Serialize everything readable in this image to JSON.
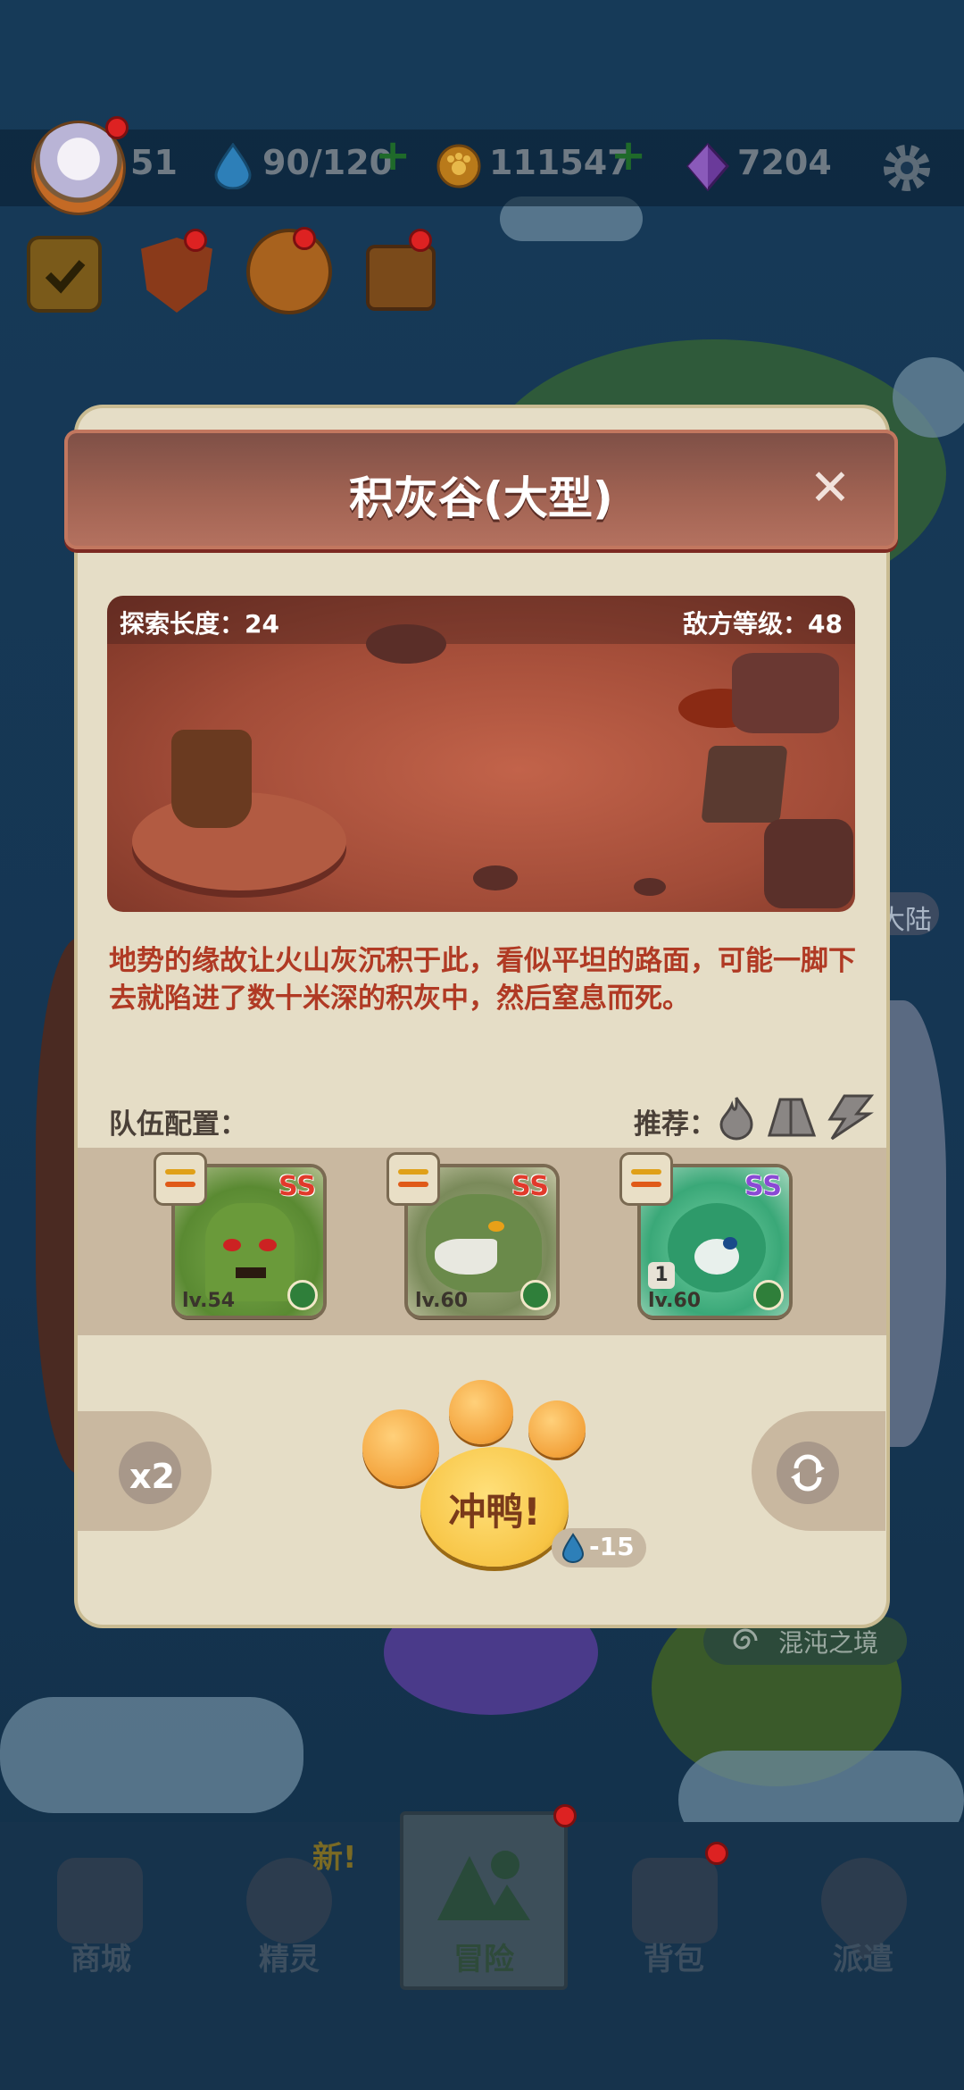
{
  "status_bar": {
    "level": "51",
    "energy": "90/120",
    "coins": "111547",
    "gems": "7204"
  },
  "dialog": {
    "title": "积灰谷(大型)",
    "close_label": "✕",
    "explore_length": "探索长度：24",
    "enemy_level": "敌方等级：48",
    "description": "地势的缘故让火山灰沉积于此，看似平坦的路面，可能一脚下去就陷进了数十米深的积灰中，然后窒息而死。",
    "team_label": "队伍配置：",
    "recommend_label": "推荐：",
    "recommend_icons": [
      "fire-icon",
      "earth-icon",
      "lightning-icon"
    ],
    "team": [
      {
        "grade": "SS",
        "level": "lv.54",
        "element": "leaf-icon",
        "creature": "cactus"
      },
      {
        "grade": "SS",
        "level": "lv.60",
        "element": "leaf-icon",
        "creature": "wolf"
      },
      {
        "grade": "SS",
        "level": "lv.60",
        "element": "leaf-icon",
        "creature": "green-dragon",
        "count": "1"
      }
    ],
    "speed_label": "x2",
    "go_label": "冲鸭!",
    "cost": "-15"
  },
  "map_labels": {
    "chaos": "混沌之境",
    "continent": "大陆"
  },
  "nav": {
    "new_badge": "新!",
    "items": [
      {
        "label": "商城",
        "icon": "shop-icon"
      },
      {
        "label": "精灵",
        "icon": "spirit-icon"
      },
      {
        "label": "冒险",
        "icon": "mountain-icon"
      },
      {
        "label": "背包",
        "icon": "backpack-icon"
      },
      {
        "label": "派遣",
        "icon": "map-pin-icon"
      }
    ]
  },
  "colors": {
    "dialog_bg": "#e5ddc6",
    "header": "#a06252",
    "description": "#b03a24",
    "accent_gold": "#f7c444"
  }
}
